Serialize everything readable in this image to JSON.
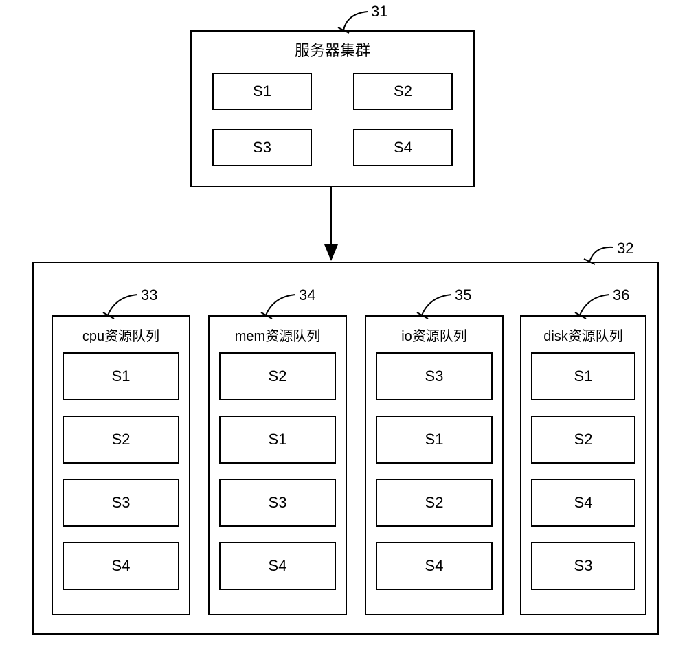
{
  "cluster": {
    "label": "31",
    "title": "服务器集群",
    "servers": [
      "S1",
      "S2",
      "S3",
      "S4"
    ]
  },
  "bottomContainer": {
    "label": "32"
  },
  "queues": [
    {
      "label": "33",
      "title": "cpu资源队列",
      "items": [
        "S1",
        "S2",
        "S3",
        "S4"
      ]
    },
    {
      "label": "34",
      "title": "mem资源队列",
      "items": [
        "S2",
        "S1",
        "S3",
        "S4"
      ]
    },
    {
      "label": "35",
      "title": "io资源队列",
      "items": [
        "S3",
        "S1",
        "S2",
        "S4"
      ]
    },
    {
      "label": "36",
      "title": "disk资源队列",
      "items": [
        "S1",
        "S2",
        "S4",
        "S3"
      ]
    }
  ]
}
